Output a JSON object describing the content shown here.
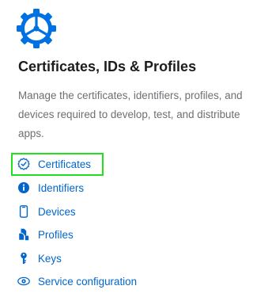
{
  "page": {
    "title": "Certificates, IDs & Profiles",
    "description": "Manage the certificates, identifiers, profiles, and devices required to develop, test, and distribute apps."
  },
  "nav": {
    "items": [
      {
        "label": "Certificates",
        "icon": "certificate-badge-icon",
        "selected": true
      },
      {
        "label": "Identifiers",
        "icon": "info-icon",
        "selected": false
      },
      {
        "label": "Devices",
        "icon": "phone-icon",
        "selected": false
      },
      {
        "label": "Profiles",
        "icon": "documents-icon",
        "selected": false
      },
      {
        "label": "Keys",
        "icon": "key-icon",
        "selected": false
      },
      {
        "label": "Service configuration",
        "icon": "service-config-icon",
        "selected": false
      }
    ]
  },
  "colors": {
    "accent": "#0066cc",
    "title": "#1d1d1f",
    "description": "#6e6e73",
    "highlight": "#22e01d"
  }
}
